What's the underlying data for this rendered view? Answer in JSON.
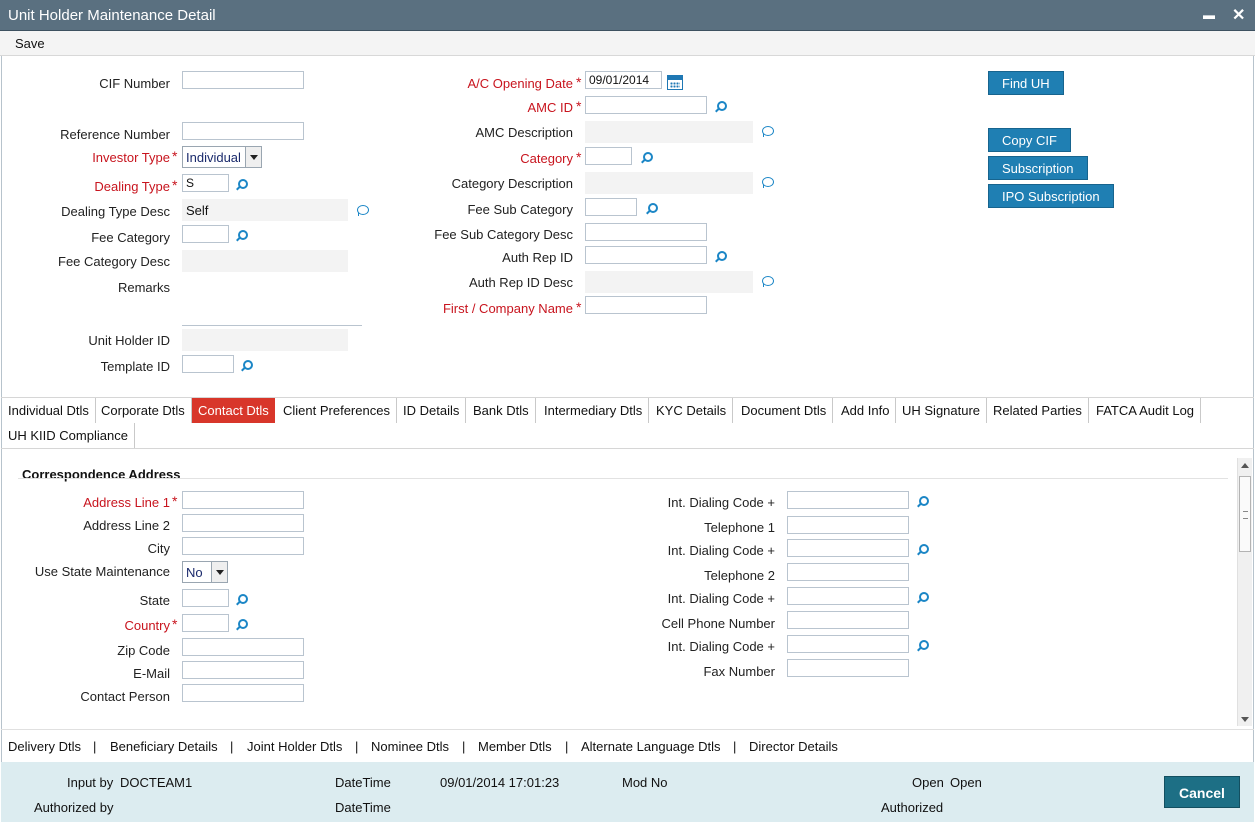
{
  "window": {
    "title": "Unit Holder Maintenance Detail",
    "minimize_glyph": "▬",
    "close_glyph": "✕"
  },
  "toolbar": {
    "save_label": "Save"
  },
  "header": {
    "cif_number": {
      "label": "CIF Number",
      "value": ""
    },
    "reference_number": {
      "label": "Reference Number",
      "value": ""
    },
    "investor_type": {
      "label": "Investor Type",
      "value": "Individual"
    },
    "dealing_type": {
      "label": "Dealing Type",
      "value": "S"
    },
    "dealing_type_desc": {
      "label": "Dealing Type Desc",
      "value": "Self"
    },
    "fee_category": {
      "label": "Fee Category",
      "value": ""
    },
    "fee_category_desc": {
      "label": "Fee Category Desc",
      "value": ""
    },
    "remarks": {
      "label": "Remarks",
      "value": ""
    },
    "unit_holder_id": {
      "label": "Unit Holder ID",
      "value": ""
    },
    "template_id": {
      "label": "Template ID",
      "value": ""
    },
    "ac_opening_date": {
      "label": "A/C Opening Date",
      "value": "09/01/2014"
    },
    "amc_id": {
      "label": "AMC ID",
      "value": ""
    },
    "amc_description": {
      "label": "AMC Description",
      "value": ""
    },
    "category": {
      "label": "Category",
      "value": ""
    },
    "category_description": {
      "label": "Category Description",
      "value": ""
    },
    "fee_sub_category": {
      "label": "Fee Sub Category",
      "value": ""
    },
    "fee_sub_category_desc": {
      "label": "Fee Sub Category Desc",
      "value": ""
    },
    "auth_rep_id": {
      "label": "Auth Rep ID",
      "value": ""
    },
    "auth_rep_id_desc": {
      "label": "Auth Rep ID Desc",
      "value": ""
    },
    "first_company_name": {
      "label": "First / Company Name",
      "value": ""
    },
    "required_marker": "*"
  },
  "actions": {
    "find_uh": "Find UH",
    "copy_cif": "Copy CIF",
    "subscription": "Subscription",
    "ipo_subscription": "IPO Subscription"
  },
  "tabs": [
    {
      "label": "Individual Dtls"
    },
    {
      "label": "Corporate Dtls"
    },
    {
      "label": "Contact Dtls",
      "active": true
    },
    {
      "label": "Client Preferences"
    },
    {
      "label": "ID Details"
    },
    {
      "label": "Bank Dtls"
    },
    {
      "label": "Intermediary Dtls"
    },
    {
      "label": "KYC Details"
    },
    {
      "label": "Document Dtls"
    },
    {
      "label": "Add Info"
    },
    {
      "label": "UH Signature"
    },
    {
      "label": "Related Parties"
    },
    {
      "label": "FATCA Audit Log"
    },
    {
      "label": "UH KIID Compliance"
    }
  ],
  "contact": {
    "section_title": "Correspondence Address",
    "address_line_1": {
      "label": "Address Line 1",
      "value": ""
    },
    "address_line_2": {
      "label": "Address Line 2",
      "value": ""
    },
    "city": {
      "label": "City",
      "value": ""
    },
    "use_state_maintenance": {
      "label": "Use State Maintenance",
      "value": "No"
    },
    "state": {
      "label": "State",
      "value": ""
    },
    "country": {
      "label": "Country",
      "value": ""
    },
    "zip_code": {
      "label": "Zip Code",
      "value": ""
    },
    "email": {
      "label": "E-Mail",
      "value": ""
    },
    "contact_person": {
      "label": "Contact Person",
      "value": ""
    },
    "int_dialing_code_label": "Int. Dialing Code +",
    "telephone_1": {
      "label": "Telephone 1",
      "value": ""
    },
    "telephone_2": {
      "label": "Telephone 2",
      "value": ""
    },
    "cell_phone": {
      "label": "Cell Phone Number",
      "value": ""
    },
    "fax_number": {
      "label": "Fax Number",
      "value": ""
    }
  },
  "bottom_links": [
    "Delivery Dtls",
    "Beneficiary Details",
    "Joint Holder Dtls",
    "Nominee Dtls",
    "Member Dtls",
    "Alternate Language Dtls",
    "Director Details"
  ],
  "link_separator": "|",
  "footer": {
    "input_by_label": "Input by",
    "input_by_value": "DOCTEAM1",
    "datetime_label": "DateTime",
    "datetime_value": "09/01/2014 17:01:23",
    "mod_no_label": "Mod No",
    "mod_no_value": "",
    "open_label": "Open",
    "open_value": "Open",
    "authorized_by_label": "Authorized by",
    "authorized_by_value": "",
    "datetime2_label": "DateTime",
    "authorized_label": "Authorized",
    "cancel_label": "Cancel"
  },
  "colors": {
    "titlebar": "#5a7080",
    "required": "#c8141e",
    "button": "#1f7fb3",
    "active_tab": "#d8362a",
    "footer": "#dcecf0",
    "cancel": "#1d6f85",
    "icon": "#1b86c6"
  }
}
